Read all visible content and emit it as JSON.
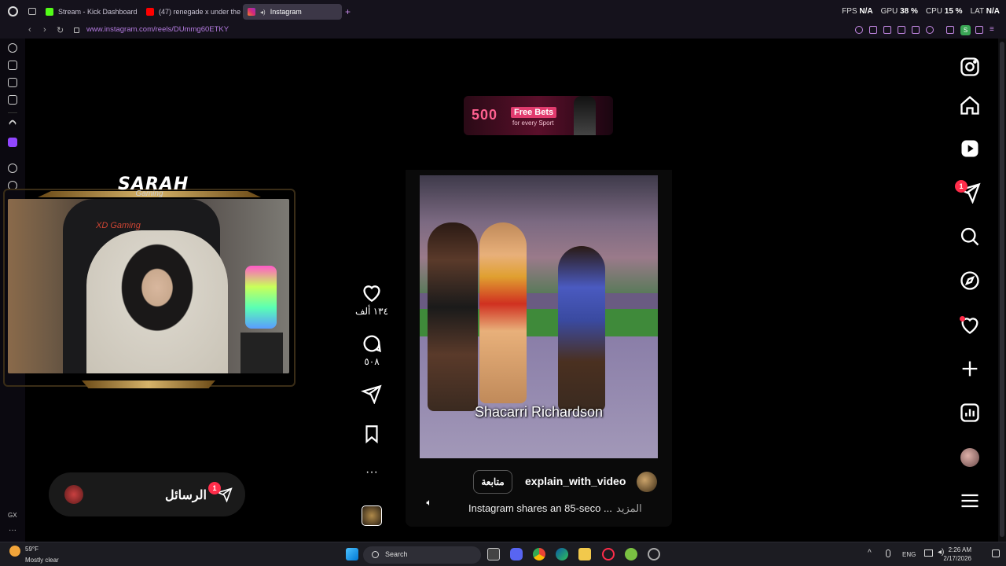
{
  "browser": {
    "tabs": [
      {
        "label": "Stream - Kick Dashboard",
        "favicon_color": "#53fc18"
      },
      {
        "label": "(47) renegade x under the",
        "favicon_color": "#ff0000"
      },
      {
        "label": "Instagram",
        "favicon_color": "#d62976"
      }
    ],
    "new_tab": "+",
    "url": "www.instagram.com/reels/DUmmg60ETKY",
    "stats": {
      "fps_label": "FPS",
      "fps_value": "N/A",
      "gpu_label": "GPU",
      "gpu_value": "38 %",
      "cpu_label": "CPU",
      "cpu_value": "15 %",
      "lat_label": "LAT",
      "lat_value": "N/A"
    },
    "sidebar_bottom_label": "GX"
  },
  "stream_overlay": {
    "logo_text": "SARAH",
    "logo_sub": "Gaming",
    "chair_brand": "XD Gaming"
  },
  "messages": {
    "label": "الرسائل",
    "badge": "1"
  },
  "reel": {
    "ad": {
      "number": "500",
      "tag": "Free Bets",
      "sub": "for every Sport"
    },
    "video_caption": "Shacarri Richardson",
    "author": "explain_with_video",
    "follow_label": "متابعة",
    "caption": "Instagram shares an 85-seco ...",
    "more_label": "المزيد",
    "likes": "١٣٤ ألف",
    "comments": "٥٠٨"
  },
  "ig_nav": {
    "notification_badge": "1"
  },
  "taskbar": {
    "weather_temp": "59°F",
    "weather_desc": "Mostly clear",
    "search_label": "Search",
    "lang": "ENG",
    "time": "2:26 AM",
    "date": "2/17/2026"
  },
  "colors": {
    "accent": "#c78ae8",
    "badge": "#ff2d4a",
    "ad_pink": "#e13b6e"
  }
}
